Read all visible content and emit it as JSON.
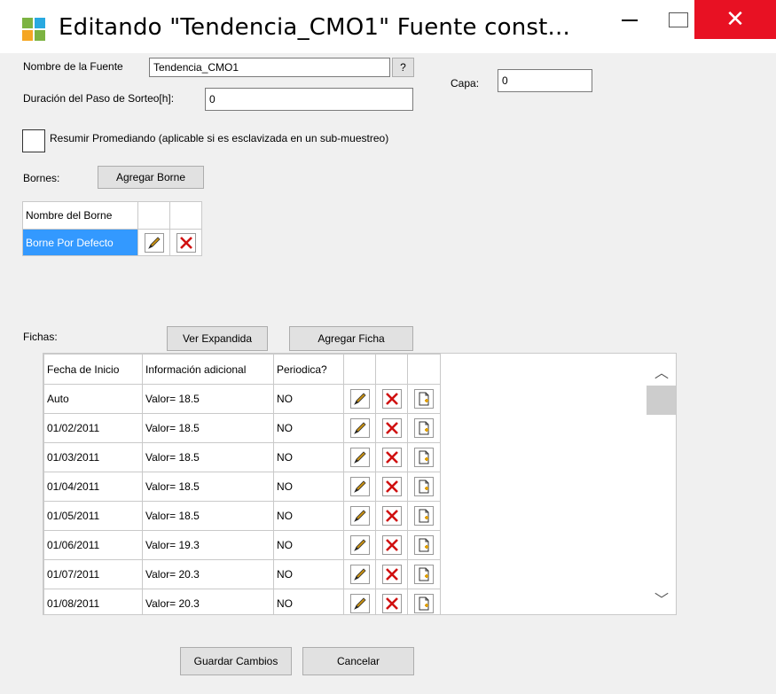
{
  "window": {
    "title": "Editando \"Tendencia_CMO1\" Fuente const...",
    "minimize_icon": "minimize-icon",
    "maximize_icon": "maximize-icon",
    "close_icon": "close-icon",
    "close_color": "#e81123"
  },
  "form": {
    "source_name_label": "Nombre de la Fuente",
    "source_name_value": "Tendencia_CMO1",
    "help_label": "?",
    "layer_label": "Capa:",
    "layer_value": "0",
    "step_label": "Duración del Paso de Sorteo[h]:",
    "step_value": "0",
    "summary_label": "Resumir Promediando (aplicable si es esclavizada en un sub-muestreo)"
  },
  "bornes": {
    "label": "Bornes:",
    "add_button": "Agregar Borne",
    "header": "Nombre del Borne",
    "rows": [
      "Borne Por Defecto"
    ],
    "selected_color": "#3399ff"
  },
  "fichas": {
    "label": "Fichas:",
    "expand_button": "Ver Expandida",
    "add_button": "Agregar Ficha",
    "headers": [
      "Fecha de Inicio",
      "Información adicional",
      "Periodica?"
    ],
    "rows": [
      {
        "date": "Auto",
        "info": "Valor= 18.5",
        "periodic": "NO"
      },
      {
        "date": "01/02/2011",
        "info": "Valor= 18.5",
        "periodic": "NO"
      },
      {
        "date": "01/03/2011",
        "info": "Valor= 18.5",
        "periodic": "NO"
      },
      {
        "date": "01/04/2011",
        "info": "Valor= 18.5",
        "periodic": "NO"
      },
      {
        "date": "01/05/2011",
        "info": "Valor= 18.5",
        "periodic": "NO"
      },
      {
        "date": "01/06/2011",
        "info": "Valor= 19.3",
        "periodic": "NO"
      },
      {
        "date": "01/07/2011",
        "info": "Valor= 20.3",
        "periodic": "NO"
      },
      {
        "date": "01/08/2011",
        "info": "Valor= 20.3",
        "periodic": "NO"
      }
    ],
    "row_icons": [
      "edit-icon",
      "delete-icon",
      "clone-icon"
    ]
  },
  "footer": {
    "save_button": "Guardar Cambios",
    "cancel_button": "Cancelar"
  }
}
